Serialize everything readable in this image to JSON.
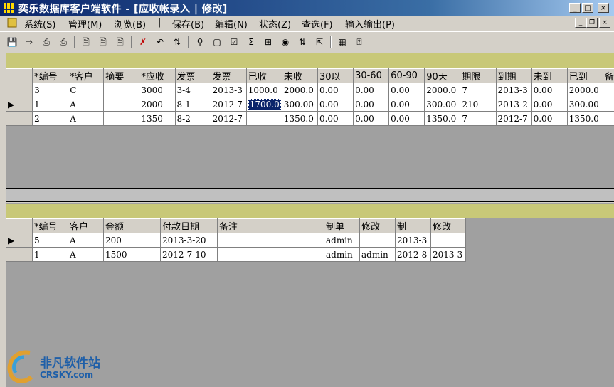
{
  "window": {
    "title": "奕乐数据库客户端软件 - [应收帐录入 | 修改]",
    "controls": {
      "minimize": "_",
      "maximize": "□",
      "close": "×"
    }
  },
  "menu": {
    "items": [
      "系统(S)",
      "管理(M)",
      "浏览(B)",
      "|",
      "保存(B)",
      "编辑(N)",
      "状态(Z)",
      "查选(F)",
      "输入输出(P)"
    ],
    "mdi_controls": {
      "minimize": "_",
      "restore": "❐",
      "close": "×"
    }
  },
  "toolbar": {
    "icons": [
      "save-icon",
      "exit-icon",
      "print-icon",
      "print-preview-icon",
      "new-doc-icon",
      "copy-doc-icon",
      "paste-doc-icon",
      "delete-icon",
      "undo-icon",
      "refresh-icon",
      "find-icon",
      "window-icon",
      "check-icon",
      "sum-icon",
      "calc-icon",
      "view-icon",
      "sort-icon",
      "export-icon",
      "filter-icon",
      "help-icon"
    ]
  },
  "upper_grid": {
    "columns": [
      "*编号",
      "*客户",
      "摘要",
      "*应收",
      "发票",
      "发票",
      "已收",
      "未收",
      "30以",
      "30-60",
      "60-90",
      "90天",
      "期限",
      "到期",
      "未到",
      "已到",
      "备"
    ],
    "rows": [
      {
        "indicator": "",
        "cells": [
          "3",
          "C",
          "",
          "3000",
          "3-4",
          "2013-3",
          "1000.0",
          "2000.0",
          "0.00",
          "0.00",
          "0.00",
          "2000.0",
          "7",
          "2013-3",
          "0.00",
          "2000.0",
          ""
        ]
      },
      {
        "indicator": "▶",
        "cells": [
          "1",
          "A",
          "",
          "2000",
          "8-1",
          "2012-7",
          "1700.0",
          "300.00",
          "0.00",
          "0.00",
          "0.00",
          "300.00",
          "210",
          "2013-2",
          "0.00",
          "300.00",
          ""
        ]
      },
      {
        "indicator": "",
        "cells": [
          "2",
          "A",
          "",
          "1350",
          "8-2",
          "2012-7",
          "",
          "1350.0",
          "0.00",
          "0.00",
          "0.00",
          "1350.0",
          "7",
          "2012-7",
          "0.00",
          "1350.0",
          ""
        ]
      }
    ]
  },
  "lower_grid": {
    "columns": [
      "*编号",
      "客户",
      "金额",
      "付款日期",
      "备注",
      "制单",
      "修改",
      "制",
      "修改"
    ],
    "rows": [
      {
        "indicator": "▶",
        "cells": [
          "5",
          "A",
          "200",
          "2013-3-20",
          "",
          "admin",
          "",
          "2013-3",
          ""
        ]
      },
      {
        "indicator": "",
        "cells": [
          "1",
          "A",
          "1500",
          "2012-7-10",
          "",
          "admin",
          "admin",
          "2012-8",
          "2013-3"
        ]
      }
    ]
  },
  "watermark": {
    "cn": "非凡软件站",
    "en": "CRSKY.com"
  }
}
